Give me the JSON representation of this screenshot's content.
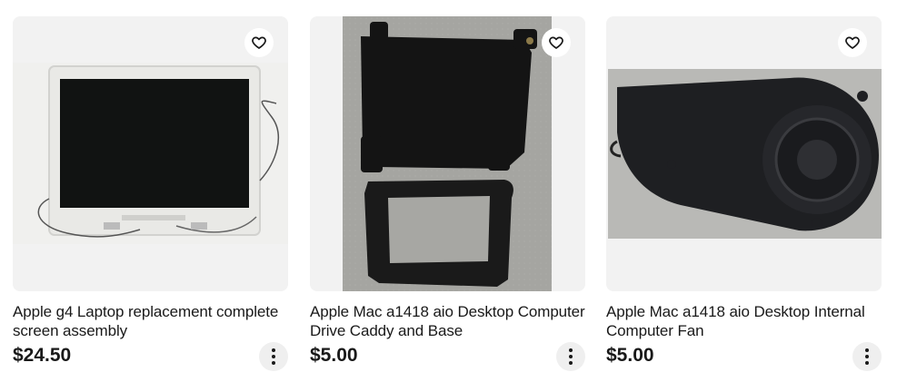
{
  "listings": [
    {
      "title": "Apple g4 Laptop replacement complete screen assembly",
      "price": "$24.50",
      "image_icon": "laptop-screen-photo"
    },
    {
      "title": "Apple Mac a1418 aio Desktop Computer Drive Caddy and Base",
      "price": "$5.00",
      "image_icon": "drive-caddy-photo"
    },
    {
      "title": "Apple Mac a1418 aio Desktop Internal Computer Fan",
      "price": "$5.00",
      "image_icon": "computer-fan-photo"
    }
  ],
  "icons": {
    "watch": "heart-icon",
    "more": "more-vertical-icon"
  },
  "colors": {
    "card_bg": "#f2f2f2",
    "text": "#191919"
  }
}
